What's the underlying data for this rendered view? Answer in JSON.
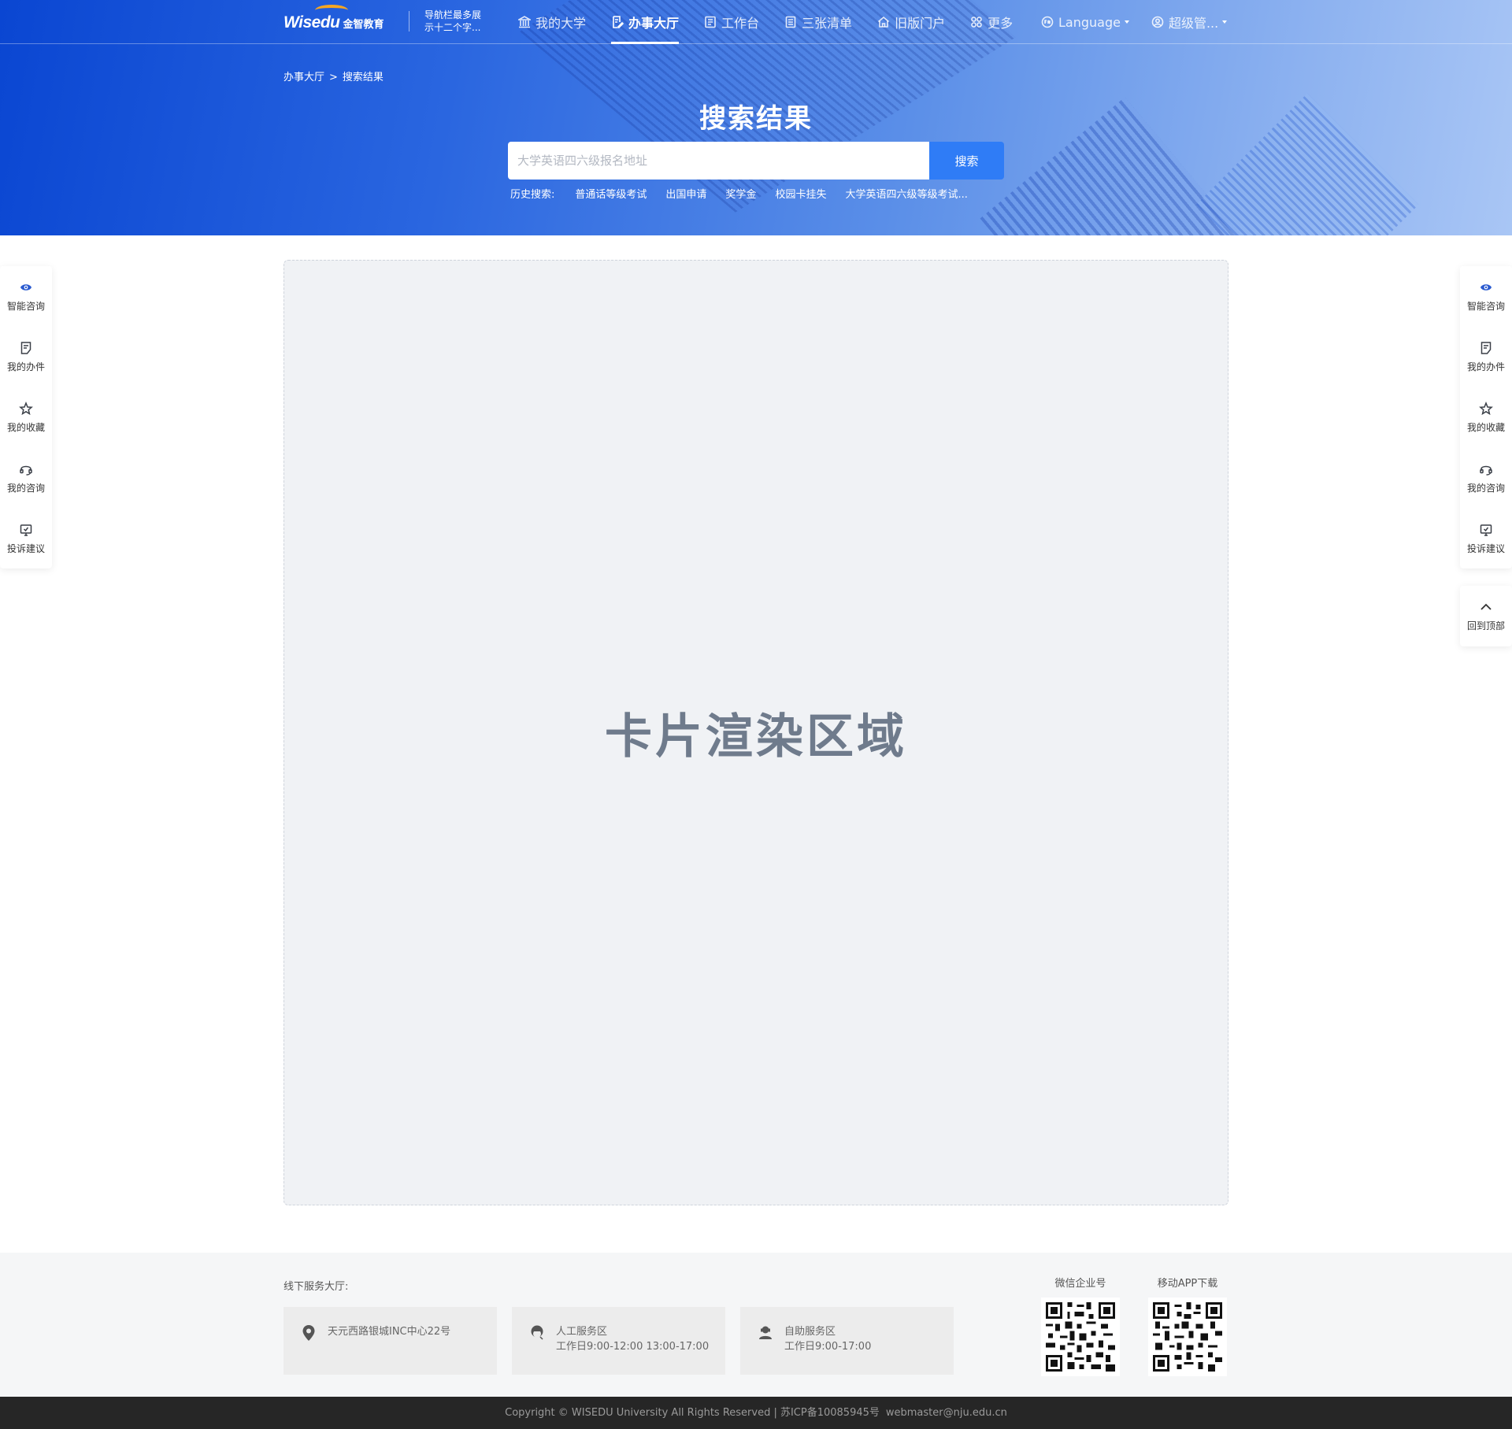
{
  "nav": {
    "logo_text": "Wisedu",
    "logo_cn": "金智教育",
    "note_line1": "导航栏最多展",
    "note_line2": "示十二个字...",
    "items": [
      {
        "label": "我的大学",
        "icon": "bank-icon"
      },
      {
        "label": "办事大厅",
        "icon": "document-edit-icon",
        "active": true
      },
      {
        "label": "工作台",
        "icon": "workbench-icon"
      },
      {
        "label": "三张清单",
        "icon": "list-icon"
      },
      {
        "label": "旧版门户",
        "icon": "home-icon"
      },
      {
        "label": "更多",
        "icon": "grid-dots-icon"
      }
    ],
    "language_label": "Language",
    "user_label": "超级管..."
  },
  "breadcrumb": {
    "root": "办事大厅",
    "separator": ">",
    "current": "搜索结果"
  },
  "page_title": "搜索结果",
  "search": {
    "placeholder": "大学英语四六级报名地址",
    "button_label": "搜索"
  },
  "history": {
    "label": "历史搜索:",
    "items": [
      "普通话等级考试",
      "出国申请",
      "奖学金",
      "校园卡挂失",
      "大学英语四六级等级考试..."
    ]
  },
  "card_area": {
    "placeholder": "卡片渲染区域"
  },
  "sidebar": {
    "items": [
      {
        "label": "智能咨询",
        "icon": "smart-consult-icon"
      },
      {
        "label": "我的办件",
        "icon": "document-icon"
      },
      {
        "label": "我的收藏",
        "icon": "star-icon"
      },
      {
        "label": "我的咨询",
        "icon": "headset-icon"
      },
      {
        "label": "投诉建议",
        "icon": "feedback-icon"
      }
    ],
    "back_to_top": "回到顶部"
  },
  "footer": {
    "title": "线下服务大厅:",
    "services": [
      {
        "line1": "天元西路银城INC中心22号",
        "line2": "",
        "icon": "location-icon"
      },
      {
        "line1": "人工服务区",
        "line2": "工作日9:00-12:00 13:00-17:00",
        "icon": "staff-icon"
      },
      {
        "line1": "自助服务区",
        "line2": "工作日9:00-17:00",
        "icon": "self-service-icon"
      }
    ],
    "qr": [
      {
        "label": "微信企业号"
      },
      {
        "label": "移动APP下载"
      }
    ]
  },
  "copyright": {
    "text": "Copyright © WISEDU University All Rights Reserved | 苏ICP备10085945号",
    "email": "webmaster@nju.edu.cn"
  },
  "colors": {
    "accent": "#2f7cf6",
    "hero_start": "#0a46d2",
    "hero_end": "#a9c6f5",
    "card_bg": "#f0f2f5",
    "card_text": "#6f7b8c",
    "footer_bg": "#f5f6f7",
    "copyright_bg": "#262626"
  }
}
